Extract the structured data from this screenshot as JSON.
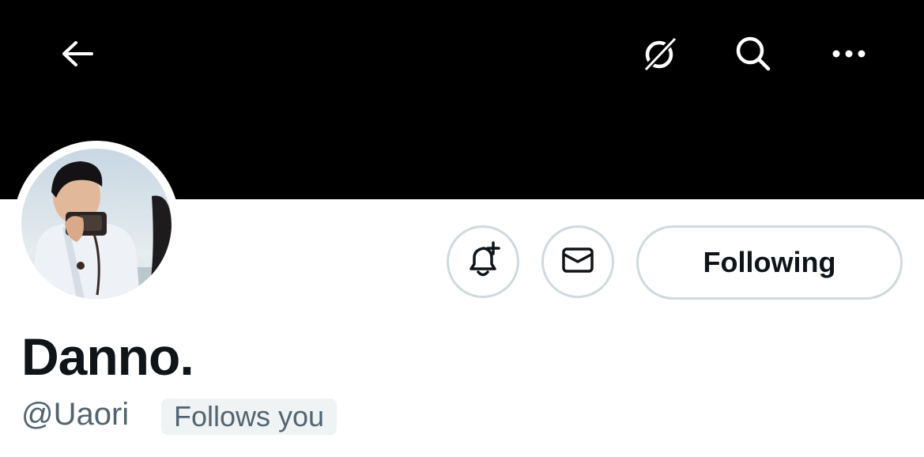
{
  "header": {
    "icons": [
      "back-arrow-icon",
      "grok-icon",
      "search-icon",
      "more-icon"
    ],
    "banner_color": "#000000"
  },
  "profile": {
    "display_name": "Danno.",
    "handle": "@Uaori",
    "follows_you_badge": "Follows you",
    "avatar_description_icon": "avatar-photo"
  },
  "actions": {
    "notify_icon": "bell-plus-icon",
    "message_icon": "envelope-icon",
    "following_label": "Following"
  },
  "colors": {
    "text_primary": "#0f1419",
    "text_secondary": "#536471",
    "border": "#cfd9de",
    "badge_bg": "#eff3f4"
  }
}
